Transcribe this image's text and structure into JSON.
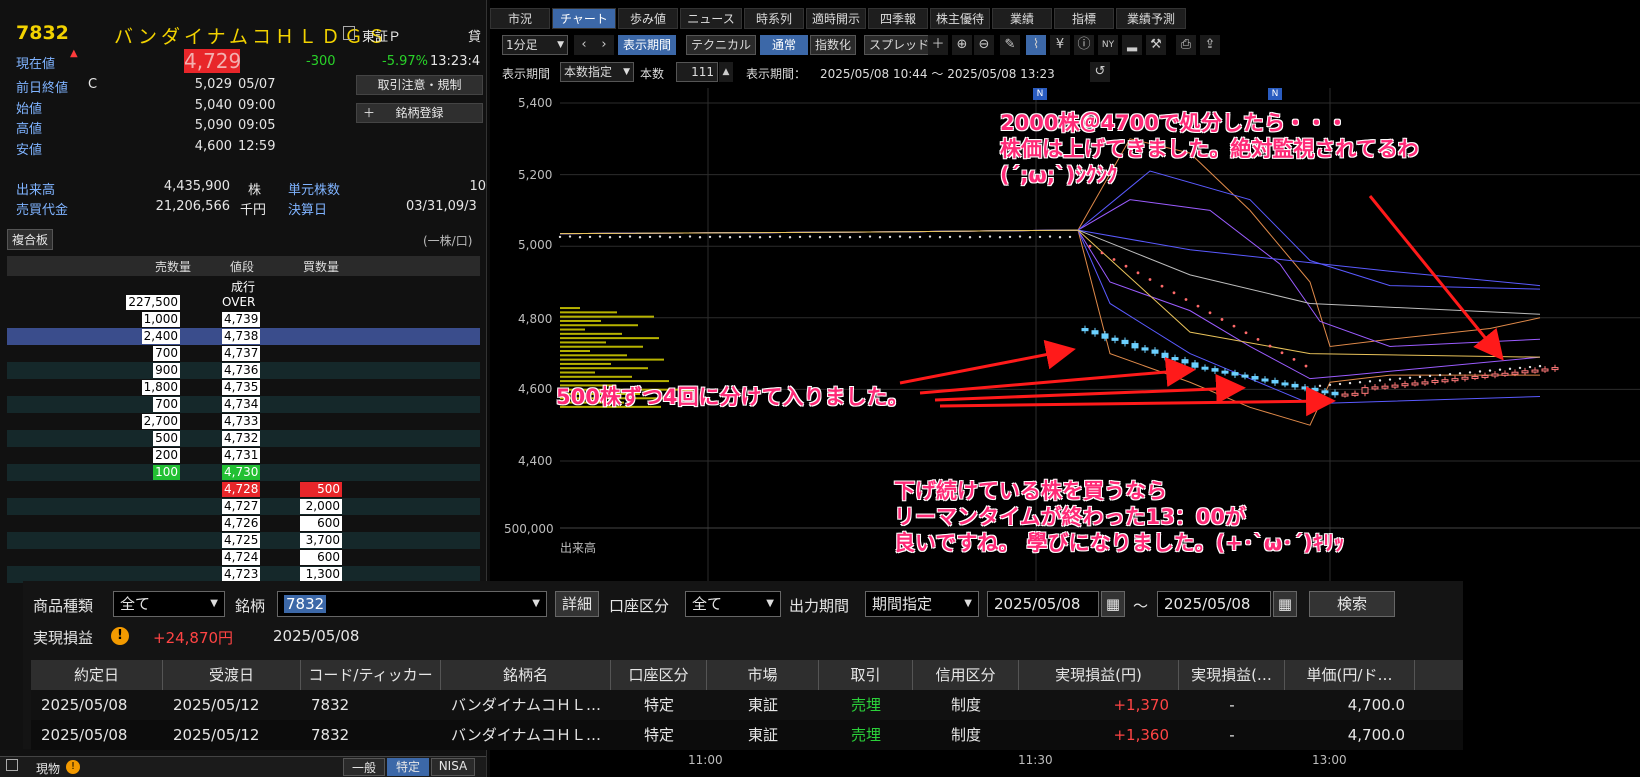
{
  "quote": {
    "code": "7832",
    "name": "バンダイナムコＨＬＤＧＳ",
    "market": "東証Ｐ",
    "lend": "貸",
    "current_label": "現在値",
    "current_price": "4,729",
    "change": "-300",
    "change_pct": "-5.97%",
    "time": "13:23:4",
    "prev_close_label": "前日終値",
    "prev_close_flag": "C",
    "prev_close": "5,029",
    "prev_close_date": "05/07",
    "open_label": "始値",
    "open": "5,040",
    "open_time": "09:00",
    "high_label": "高値",
    "high": "5,090",
    "high_time": "09:05",
    "low_label": "安値",
    "low": "4,600",
    "low_time": "12:59",
    "volume_label": "出来高",
    "volume": "4,435,900",
    "volume_unit": "株",
    "turnover_label": "売買代金",
    "turnover": "21,206,566",
    "turnover_unit": "千円",
    "unit_shares_label": "単元株数",
    "unit_shares": "10",
    "settlement_label": "決算日",
    "settlement": "03/31,09/3",
    "btn_notice": "取引注意・規制",
    "btn_register": "銘柄登録",
    "btn_register_plus": "＋"
  },
  "orderbook": {
    "tab": "複合板",
    "unit": "(一株/口)",
    "head_sell": "売数量",
    "head_price": "値段",
    "head_buy": "買数量",
    "market_row": "成行",
    "over_sell": "227,500",
    "over_label": "OVER",
    "asks": [
      {
        "qty": "1,000",
        "price": "4,739"
      },
      {
        "qty": "2,400",
        "price": "4,738"
      },
      {
        "qty": "700",
        "price": "4,737"
      },
      {
        "qty": "900",
        "price": "4,736"
      },
      {
        "qty": "1,800",
        "price": "4,735"
      },
      {
        "qty": "700",
        "price": "4,734"
      },
      {
        "qty": "2,700",
        "price": "4,733"
      },
      {
        "qty": "500",
        "price": "4,732"
      },
      {
        "qty": "200",
        "price": "4,731"
      },
      {
        "qty": "100",
        "price": "4,730"
      }
    ],
    "bids": [
      {
        "price": "4,728",
        "qty": "500"
      },
      {
        "price": "4,727",
        "qty": "2,000"
      },
      {
        "price": "4,726",
        "qty": "600"
      },
      {
        "price": "4,725",
        "qty": "3,700"
      },
      {
        "price": "4,724",
        "qty": "600"
      },
      {
        "price": "4,723",
        "qty": "1,300"
      }
    ]
  },
  "bottom_left": {
    "label": "現物",
    "tabs": [
      "一般",
      "特定",
      "NISA"
    ]
  },
  "chart_tabs": [
    "市況",
    "チャート",
    "歩み値",
    "ニュース",
    "時系列",
    "適時開示",
    "四季報",
    "株主優待",
    "業績",
    "指標",
    "業績予測"
  ],
  "toolbar": {
    "interval": "1分足",
    "btn_period": "表示期間",
    "btn_tech": "テクニカル",
    "btn_normal": "通常",
    "btn_index": "指数化",
    "btn_spread": "スプレッド",
    "period_label": "表示期間",
    "period_select": "本数指定",
    "count_label": "本数",
    "count_value": "111",
    "range_label": "表示期間：",
    "range_value": "2025/05/08 10:44 ～ 2025/05/08 13:23"
  },
  "chart": {
    "y_ticks": [
      "5,400",
      "5,200",
      "5,000",
      "4,800",
      "4,600",
      "4,400"
    ],
    "volume_tick": "500,000",
    "volume_label": "出来高",
    "x_ticks": [
      "11:00",
      "11:30",
      "13:00"
    ],
    "news_marker": "N",
    "annotation_top_1": "2000株＠4700で処分したら・・・",
    "annotation_top_2": "株価は上げてきました。絶対監視されてるわ",
    "annotation_top_3": "(´;ω;`)ｼｸｼｸ",
    "annotation_left": "500株ずつ4回に分けて入りました。",
    "annotation_bottom_1": "下げ続けている株を買うなら",
    "annotation_bottom_2": "リーマンタイムが終わった13：00が",
    "annotation_bottom_3": "良いですね。 學びになりました。(+･`ω･´)ｷﾘｯ"
  },
  "pnl_panel": {
    "product_label": "商品種類",
    "product_value": "全て",
    "symbol_label": "銘柄",
    "symbol_value": "7832",
    "btn_detail": "詳細",
    "account_label": "口座区分",
    "account_value": "全て",
    "period_label": "出力期間",
    "period_value": "期間指定",
    "date_from": "2025/05/08",
    "tilde": "～",
    "date_to": "2025/05/08",
    "btn_search": "検索",
    "realized_label": "実現損益",
    "realized_value": "+24,870円",
    "realized_date": "2025/05/08",
    "columns": [
      "約定日",
      "受渡日",
      "コード/ティッカー",
      "銘柄名",
      "口座区分",
      "市場",
      "取引",
      "信用区分",
      "実現損益(円)",
      "実現損益(…",
      "単価(円/ド…"
    ],
    "rows": [
      [
        "2025/05/08",
        "2025/05/12",
        "7832",
        "バンダイナムコＨＬ…",
        "特定",
        "東証",
        "売埋",
        "制度",
        "+1,370",
        "-",
        "4,700.0"
      ],
      [
        "2025/05/08",
        "2025/05/12",
        "7832",
        "バンダイナムコＨＬ…",
        "特定",
        "東証",
        "売埋",
        "制度",
        "+1,360",
        "-",
        "4,700.0"
      ]
    ]
  }
}
